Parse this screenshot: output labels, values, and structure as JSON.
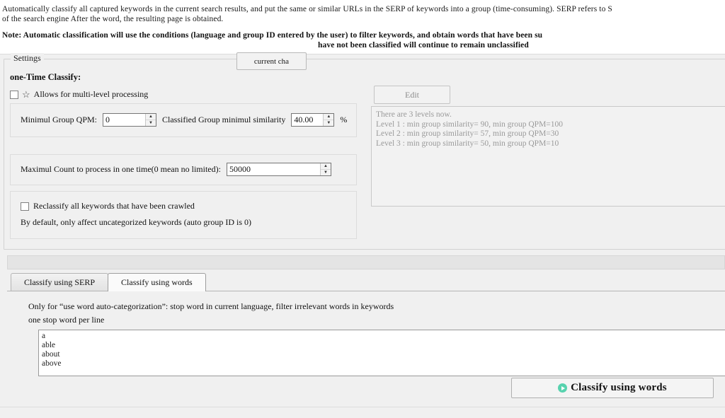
{
  "description": {
    "line1": "Automatically classify all captured keywords in the current search results, and put the same or similar URLs in the SERP of keywords into a group (time-consuming). SERP refers to S",
    "line2": "of the search engine After the word, the resulting page is obtained.",
    "note_line1": "Note: Automatic classification will use the conditions (language and group ID entered by the user) to filter keywords, and obtain words that have been su",
    "note_line2": "have not been classified will continue to remain unclassified"
  },
  "settings": {
    "legend": "Settings",
    "section_title": "one-Time Classify:",
    "multilevel": {
      "label": "Allows for multi-level processing",
      "checked": false,
      "star_icon": "star-outline-icon"
    },
    "min_group_qpm": {
      "label": "Minimul Group QPM:",
      "value": "0"
    },
    "min_similarity": {
      "label": "Classified Group minimul similarity",
      "value": "40.00",
      "unit": "%"
    },
    "max_count": {
      "label": "Maximul Count to process in one time(0 mean no limited):",
      "value": "50000"
    },
    "reclassify": {
      "label": "Reclassify all keywords that have been crawled",
      "checked": false,
      "note": "By default, only affect uncategorized keywords (auto group ID is 0)"
    }
  },
  "levels": {
    "edit_button": "Edit",
    "summary": "There are 3 levels now.",
    "lines": [
      "Level 1 : min group similarity=  90, min group QPM=100",
      "Level 2 : min group similarity=  57, min group QPM=30",
      "Level 3 : min group similarity=  50, min group QPM=10"
    ]
  },
  "tabs": [
    {
      "label": "Classify using SERP",
      "active": false
    },
    {
      "label": "Classify using words",
      "active": true
    }
  ],
  "tab_panel": {
    "line1": "Only for “use word auto-categorization”: stop word in current language, filter irrelevant words in keywords",
    "line2": "one stop word per line",
    "stop_words": [
      "a",
      "able",
      "about",
      "above"
    ]
  },
  "footer": {
    "current_button": "current cha",
    "classify_button": "Classify using words",
    "play_icon": "play-circle-icon"
  },
  "colors": {
    "accent": "#57d2ae",
    "panel_bg": "#f0f0f0",
    "field_bg": "#ffffff",
    "muted_text": "#9a9a9a"
  }
}
